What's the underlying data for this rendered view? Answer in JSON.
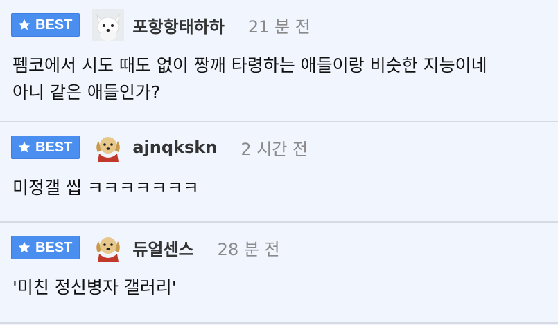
{
  "badge_label": "BEST",
  "comments": [
    {
      "nickname": "포항항태하하",
      "time": "21 분 전",
      "avatar": "white-fox-avatar",
      "lines": [
        "펨코에서 시도 때도 없이 짱깨 타령하는 애들이랑 비슷한 지능이네",
        "아니 같은 애들인가?"
      ]
    },
    {
      "nickname": "ajnqkskn",
      "time": "2 시간 전",
      "avatar": "puppy-avatar",
      "lines": [
        "미정갤 씹 ㅋㅋㅋㅋㅋㅋㅋ"
      ]
    },
    {
      "nickname": "듀얼센스",
      "time": "28 분 전",
      "avatar": "puppy-avatar",
      "lines": [
        "'미친 정신병자 갤러리'"
      ]
    }
  ],
  "colors": {
    "badge": "#4a8ef0",
    "background": "#f0f5fe",
    "divider": "#d6dae2",
    "time": "#8a8a8a"
  }
}
